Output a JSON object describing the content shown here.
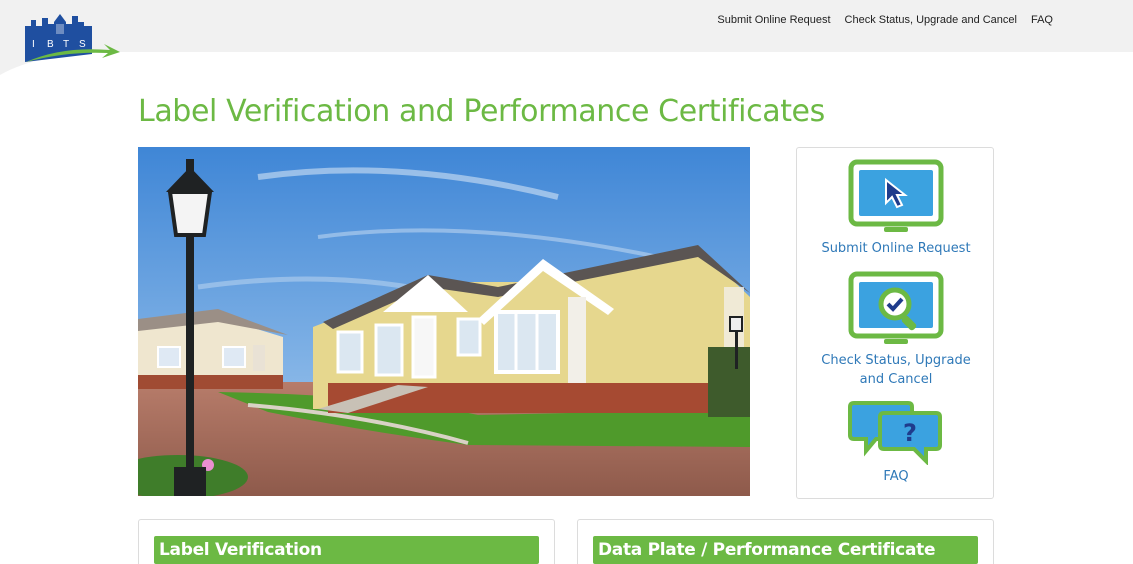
{
  "brand": {
    "logo_text": [
      "I",
      "B",
      "T",
      "S"
    ],
    "accent_color": "#6cb944",
    "link_color": "#2f79b8",
    "logo_blue": "#1f4fa0"
  },
  "nav": {
    "items": [
      {
        "label": "Submit Online Request"
      },
      {
        "label": "Check Status, Upgrade and Cancel"
      },
      {
        "label": "FAQ"
      }
    ]
  },
  "page": {
    "title": "Label Verification and Performance Certificates"
  },
  "sidebar": {
    "items": [
      {
        "label": "Submit Online Request",
        "icon": "monitor-cursor-icon"
      },
      {
        "label": "Check Status, Upgrade and Cancel",
        "icon": "monitor-search-check-icon"
      },
      {
        "label": "FAQ",
        "icon": "chat-question-icon"
      }
    ]
  },
  "cards": [
    {
      "title": "Label Verification"
    },
    {
      "title": "Data Plate / Performance Certificate"
    }
  ]
}
